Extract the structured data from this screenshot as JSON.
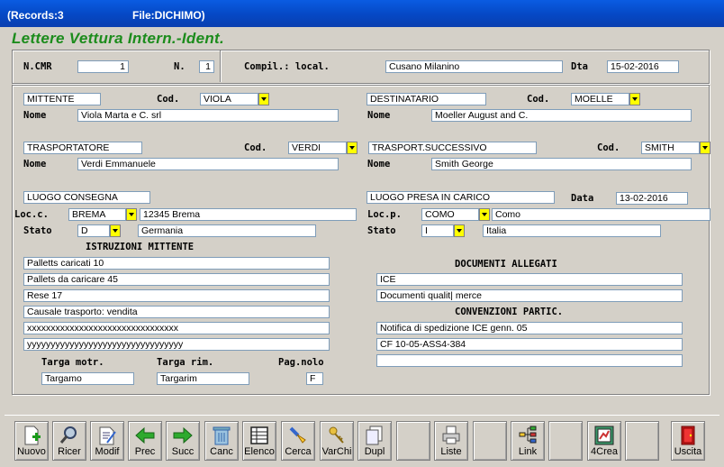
{
  "window": {
    "records": "(Records:3",
    "file": "File:DICHIMO)"
  },
  "app_title": "Lettere Vettura Intern.-Ident.",
  "header": {
    "ncmr_label": "N.CMR",
    "ncmr_value": "1",
    "n_label": "N.",
    "n_value": "1",
    "compil_label": "Compil.: local.",
    "compil_value": "Cusano Milanino",
    "dta_label": "Dta",
    "dta_value": "15-02-2016"
  },
  "mittente": {
    "title": "MITTENTE",
    "cod_label": "Cod.",
    "cod_value": "VIOLA",
    "nome_label": "Nome",
    "nome_value": "Viola Marta e C. srl"
  },
  "destinatario": {
    "title": "DESTINATARIO",
    "cod_label": "Cod.",
    "cod_value": "MOELLE",
    "nome_label": "Nome",
    "nome_value": "Moeller August and C."
  },
  "trasportatore": {
    "title": "TRASPORTATORE",
    "cod_label": "Cod.",
    "cod_value": "VERDI",
    "nome_label": "Nome",
    "nome_value": "Verdi Emmanuele"
  },
  "trasp_succ": {
    "title": "TRASPORT.SUCCESSIVO",
    "cod_label": "Cod.",
    "cod_value": "SMITH",
    "nome_label": "Nome",
    "nome_value": "Smith George"
  },
  "consegna": {
    "title": "LUOGO CONSEGNA",
    "loc_label": "Loc.c.",
    "loc_code": "BREMA",
    "loc_value": "12345 Brema",
    "stato_label": "Stato",
    "stato_code": "D",
    "stato_value": "Germania"
  },
  "presa": {
    "title": "LUOGO PRESA IN CARICO",
    "data_label": "Data",
    "data_value": "13-02-2016",
    "loc_label": "Loc.p.",
    "loc_code": "COMO",
    "loc_value": "Como",
    "stato_label": "Stato",
    "stato_code": "I",
    "stato_value": "Italia"
  },
  "istruzioni": {
    "title": "ISTRUZIONI MITTENTE",
    "lines": [
      "Palletts caricati 10",
      "Pallets da caricare 45",
      "Rese  17",
      "Causale trasporto: vendita",
      "xxxxxxxxxxxxxxxxxxxxxxxxxxxxxxxx",
      "yyyyyyyyyyyyyyyyyyyyyyyyyyyyyyyyy"
    ]
  },
  "documenti": {
    "title": "DOCUMENTI ALLEGATI",
    "lines": [
      "ICE",
      "Documenti qualit| merce"
    ]
  },
  "convenzioni": {
    "title": "CONVENZIONI PARTIC.",
    "lines": [
      "Notifica di spedizione ICE genn. 05",
      "CF  10-05-ASS4-384",
      ""
    ]
  },
  "targhe": {
    "motr_label": "Targa motr.",
    "motr_value": "Targamo",
    "rim_label": "Targa rim.",
    "rim_value": "Targarim",
    "pagnolo_label": "Pag.nolo",
    "pagnolo_value": "F"
  },
  "toolbar": {
    "nuovo": "Nuovo",
    "ricer": "Ricer",
    "modif": "Modif",
    "prec": "Prec",
    "succ": "Succ",
    "canc": "Canc",
    "elenco": "Elenco",
    "cerca": "Cerca",
    "varchi": "VarChi",
    "dupl": "Dupl",
    "liste": "Liste",
    "link": "Link",
    "crea": "4Crea",
    "uscita": "Uscita"
  }
}
